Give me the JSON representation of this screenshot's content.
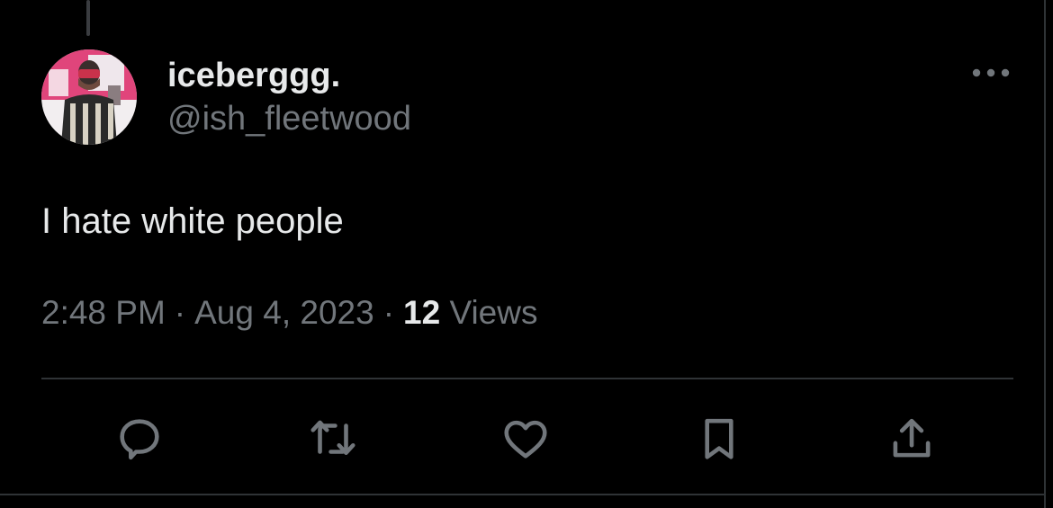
{
  "tweet": {
    "author": {
      "display_name": "iceberggg.",
      "handle": "@ish_fleetwood",
      "avatar": "profile-photo"
    },
    "text": "I hate white people",
    "meta": {
      "time": "2:48 PM",
      "separator": "·",
      "date": "Aug 4, 2023",
      "views_count": "12",
      "views_label": "Views"
    },
    "more_icon": "more-horizontal-icon",
    "actions": [
      {
        "name": "reply",
        "icon": "reply-icon"
      },
      {
        "name": "retweet",
        "icon": "retweet-icon"
      },
      {
        "name": "like",
        "icon": "heart-icon"
      },
      {
        "name": "bookmark",
        "icon": "bookmark-icon"
      },
      {
        "name": "share",
        "icon": "share-icon"
      }
    ]
  },
  "colors": {
    "background": "#000000",
    "primary_text": "#e7e9ea",
    "secondary_text": "#71767b",
    "border": "#2f3336",
    "avatar_accent": "#e0457b"
  }
}
